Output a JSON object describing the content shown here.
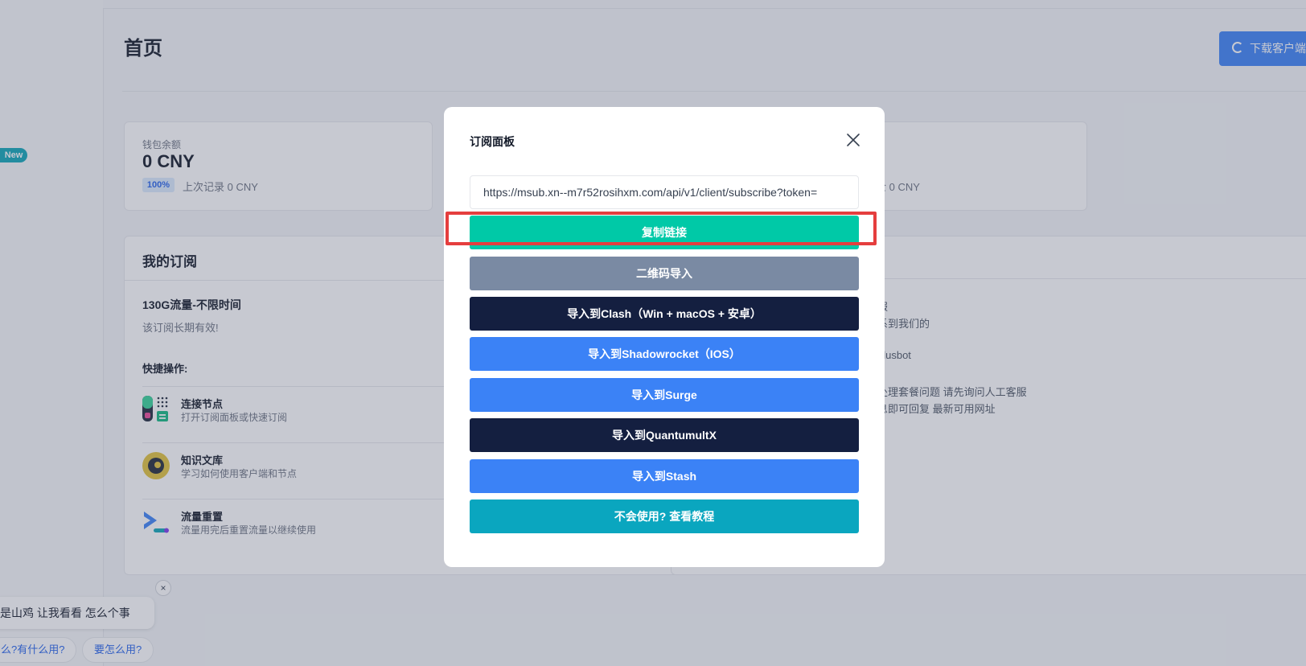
{
  "sidebar": {
    "new_badge": "New"
  },
  "header": {
    "title": "首页",
    "download_button": "下载客户端"
  },
  "wallet": {
    "label": "钱包余额",
    "amount": "0 CNY",
    "percent": "100%",
    "previous": "上次记录 0 CNY"
  },
  "stat2": {
    "text": "佥 0 CNY"
  },
  "subscription": {
    "title": "我的订阅",
    "plan_name": "130G流量-不限时间",
    "plan_validity": "该订阅长期有效!",
    "quick_title": "快捷操作:",
    "actions": [
      {
        "title": "连接节点",
        "subtitle": "打开订阅面板或快速订阅"
      },
      {
        "title": "知识文库",
        "subtitle": "学习如何使用客户端和节点"
      },
      {
        "title": "流量重置",
        "subtitle": "流量用完后重置流量以继续使用"
      }
    ]
  },
  "notice": {
    "lines": [
      "服",
      "系到我们的",
      "s",
      "plusbot",
      "处理套餐问题 请先询问人工客服",
      "息即可回复 最新可用网址"
    ]
  },
  "chat": {
    "bubble_text": "是山鸡 让我看看 怎么个事",
    "close_symbol": "×",
    "chips": [
      "么?有什么用?",
      "要怎么用?"
    ]
  },
  "modal": {
    "title": "订阅面板",
    "url": "https://msub.xn--m7r52rosihxm.com/api/v1/client/subscribe?token=",
    "buttons": [
      {
        "label": "复制链接",
        "color": "#00c9a7"
      },
      {
        "label": "二维码导入",
        "color": "#7a8aa3"
      },
      {
        "label": "导入到Clash（Win + macOS + 安卓）",
        "color": "#141f40"
      },
      {
        "label": "导入到Shadowrocket（IOS）",
        "color": "#3b82f6"
      },
      {
        "label": "导入到Surge",
        "color": "#3b82f6"
      },
      {
        "label": "导入到QuantumultX",
        "color": "#141f40"
      },
      {
        "label": "导入到Stash",
        "color": "#3b82f6"
      },
      {
        "label": "不会使用? 查看教程",
        "color": "#0aa6bf"
      }
    ]
  },
  "colors": {
    "accent": "#3b82f6",
    "highlight": "#e53e3e"
  }
}
